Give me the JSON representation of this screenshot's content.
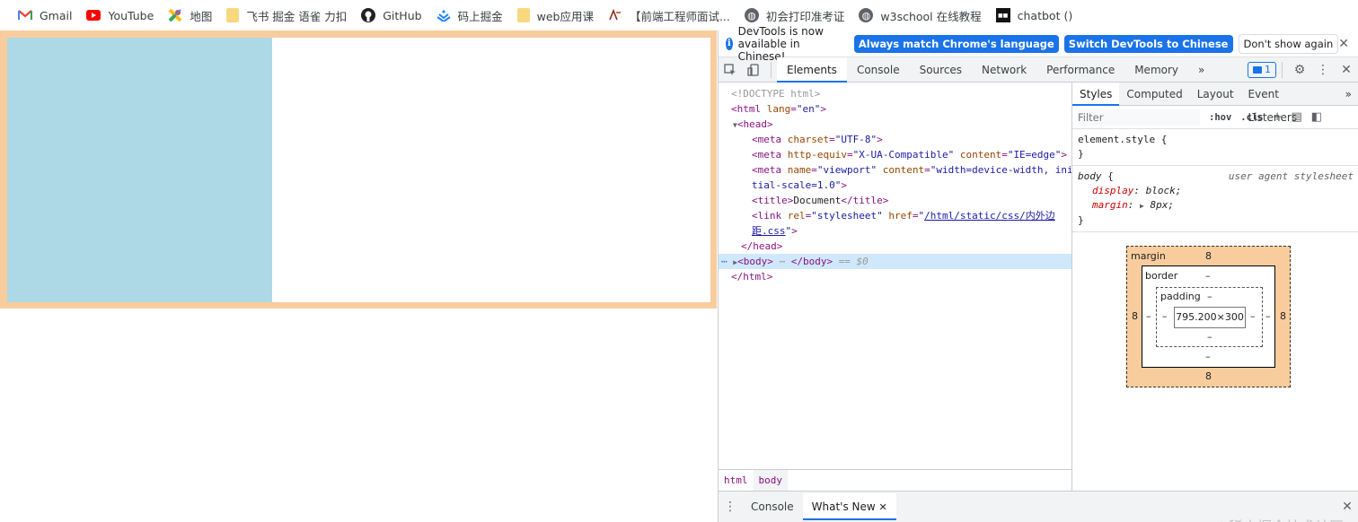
{
  "bookmarks": [
    {
      "label": "Gmail",
      "icon": "gmail-icon"
    },
    {
      "label": "YouTube",
      "icon": "youtube-icon"
    },
    {
      "label": "地图",
      "icon": "maps-icon"
    },
    {
      "label": "飞书 掘金 语雀 力扣",
      "icon": "folder-icon"
    },
    {
      "label": "GitHub",
      "icon": "github-icon"
    },
    {
      "label": "码上掘金",
      "icon": "juejin-icon"
    },
    {
      "label": "web应用课",
      "icon": "folder-icon"
    },
    {
      "label": "【前端工程师面试...",
      "icon": "acwing-icon"
    },
    {
      "label": "初会打印准考证",
      "icon": "globe-icon"
    },
    {
      "label": "w3school 在线教程",
      "icon": "globe-icon"
    },
    {
      "label": "chatbot ()",
      "icon": "chatbot-icon"
    }
  ],
  "page": {
    "margin_color": "#f9cc9d",
    "box_color": "#add8e6"
  },
  "devtools": {
    "infobar": {
      "message": "DevTools is now available in Chinese!",
      "btn_match": "Always match Chrome's language",
      "btn_switch": "Switch DevTools to Chinese",
      "btn_dismiss": "Don't show again",
      "close": "✕"
    },
    "tabs": [
      "Elements",
      "Console",
      "Sources",
      "Network",
      "Performance",
      "Memory"
    ],
    "more": "»",
    "issues_count": "1",
    "elements": {
      "doctype": "<!DOCTYPE html>",
      "html_lang": "en",
      "meta_charset": "UTF-8",
      "meta_http_equiv": "X-UA-Compatible",
      "meta_http_content": "IE=edge",
      "meta_name": "viewport",
      "meta_viewport_content_1": "width=device-width, ini",
      "meta_viewport_content_2": "tial-scale=1.0",
      "title_text": "Document",
      "link_rel": "stylesheet",
      "link_href_1": "/html/static/css/内外边",
      "link_href_2": "距.css",
      "body_eq": "== $0",
      "ellipsis": "⋯"
    },
    "breadcrumb": [
      "html",
      "body"
    ],
    "styles": {
      "subtabs": [
        "Styles",
        "Computed",
        "Layout",
        "Event Listeners"
      ],
      "filter_placeholder": "Filter",
      "hov": ":hov",
      "cls": ".cls",
      "element_style": "element.style",
      "body_selector": "body",
      "ua_label": "user agent stylesheet",
      "prop1_name": "display",
      "prop1_value": "block;",
      "prop2_name": "margin",
      "prop2_value": "8px;"
    },
    "box_model": {
      "margin_label": "margin",
      "margin_top": "8",
      "margin_bottom": "8",
      "margin_left": "8",
      "margin_right": "8",
      "border_label": "border",
      "border_value": "–",
      "padding_label": "padding",
      "padding_value": "–",
      "content_size": "795.200×300"
    },
    "drawer": {
      "tabs": [
        "Console",
        "What's New"
      ],
      "close": "✕"
    }
  },
  "watermark": "@稀土掘金技术社区"
}
